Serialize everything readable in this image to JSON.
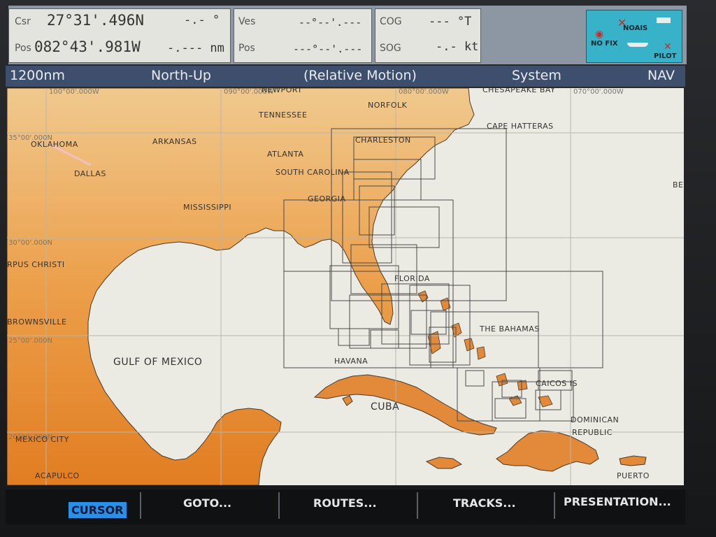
{
  "header": {
    "position": {
      "csr_label": "Csr",
      "lat": "27°31'.496N",
      "lat_unit": "-.- °",
      "pos_label": "Pos",
      "lon": "082°43'.981W",
      "lon_unit": "-.--- nm"
    },
    "vessel": {
      "ves_label": "Ves",
      "ves_value": "--°--'.---",
      "pos_label": "Pos",
      "pos_value": "---°--'.---"
    },
    "course": {
      "cog_label": "COG",
      "cog_value": "--- °T",
      "sog_label": "SOG",
      "sog_value": "-.- kt"
    },
    "status": {
      "noais": "NOAIS",
      "nofix": "NO FIX",
      "pilot": "PILOT"
    }
  },
  "mode_bar": {
    "range": "1200nm",
    "orientation": "North-Up",
    "motion": "(Relative Motion)",
    "system": "System",
    "nav": "NAV"
  },
  "chart": {
    "coords": {
      "lon_100": "100°00'.000W",
      "lon_090": "090°00'.000W",
      "lon_080": "080°00'.000W",
      "lon_070": "070°00'.000W",
      "lat_35": "35°00'.000N",
      "lat_30": "30°00'.000N",
      "lat_25": "25°00'.000N",
      "lat_20": "20°00'.000N"
    },
    "labels": {
      "tennessee": "TENNESSEE",
      "norfolk": "NORFOLK",
      "chesapeake": "CHESAPEAKE BAY",
      "newport": "NEWPORT",
      "cape_hatteras": "CAPE HATTERAS",
      "oklahoma": "OKLAHOMA",
      "arkansas": "ARKANSAS",
      "charleston": "CHARLESTON",
      "atlanta": "ATLANTA",
      "south_carolina": "SOUTH CAROLINA",
      "dallas": "DALLAS",
      "georgia": "GEORGIA",
      "mississippi": "MISSISSIPPI",
      "corpus_christi": "RPUS CHRISTI",
      "florida": "FLORIDA",
      "brownsville": "BROWNSVILLE",
      "bahamas": "THE BAHAMAS",
      "gulf": "GULF OF MEXICO",
      "havana": "HAVANA",
      "caicos": "CAICOS IS",
      "cuba": "CUBA",
      "mexico_city": "MEXICO CITY",
      "dominican": "DOMINICAN",
      "republic": "REPUBLIC",
      "acapulco": "ACAPULCO",
      "puerto": "PUERTO",
      "be": "BE"
    }
  },
  "softkeys": {
    "cursor": "CURSOR",
    "goto": "GOTO...",
    "routes": "ROUTES...",
    "tracks": "TRACKS...",
    "presentation": "PRESENTATION..."
  },
  "colors": {
    "land": "#e6963e",
    "sea": "#ecebe3",
    "mode_bar": "#3e4f6e",
    "status_box": "#38b2c9",
    "cursor_key": "#2a8fe6"
  }
}
